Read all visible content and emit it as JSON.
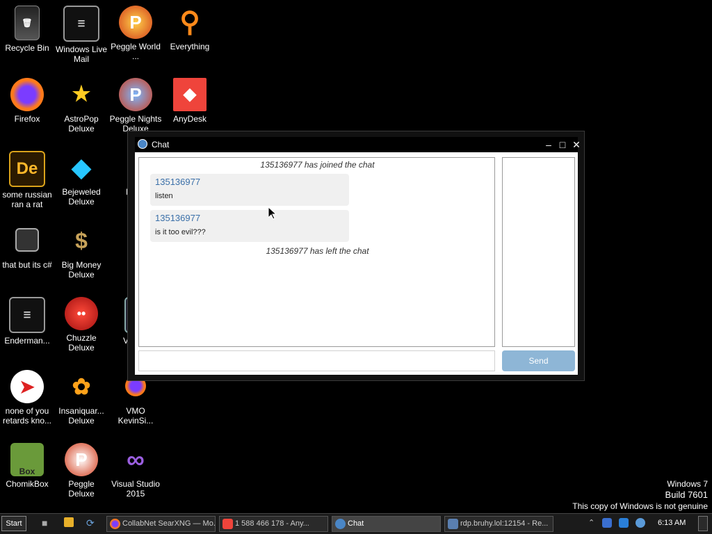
{
  "desktop": {
    "icons": [
      {
        "label": "Recycle Bin",
        "icon": "recycle-bin-icon"
      },
      {
        "label": "Windows Live Mail",
        "icon": "mail-icon"
      },
      {
        "label": "Peggle World ...",
        "icon": "peggle-icon"
      },
      {
        "label": "Everything",
        "icon": "search-icon"
      },
      {
        "label": "Firefox",
        "icon": "firefox-icon"
      },
      {
        "label": "AstroPop Deluxe",
        "icon": "astropop-icon"
      },
      {
        "label": "Peggle Nights Deluxe",
        "icon": "peggle-nights-icon"
      },
      {
        "label": "AnyDesk",
        "icon": "anydesk-icon"
      },
      {
        "label": "some russian ran a rat",
        "icon": "document-icon"
      },
      {
        "label": "Bejeweled Deluxe",
        "icon": "gem-icon"
      },
      {
        "label": "Pl Zo",
        "icon": "game-icon"
      },
      {
        "label": "that but its c#",
        "icon": "shortcut-icon"
      },
      {
        "label": "Big Money Deluxe",
        "icon": "money-bag-icon"
      },
      {
        "label": "Zum",
        "icon": "game-icon"
      },
      {
        "label": "Enderman...",
        "icon": "mail-icon"
      },
      {
        "label": "Chuzzle Deluxe",
        "icon": "chuzzle-icon"
      },
      {
        "label": "VM Ke",
        "icon": "vm-icon"
      },
      {
        "label": "none of you retards kno...",
        "icon": "bird-icon"
      },
      {
        "label": "Insaniquar... Deluxe",
        "icon": "fish-icon"
      },
      {
        "label": "VMO KevinSi...",
        "icon": "firefox-icon"
      },
      {
        "label": "ChomikBox",
        "icon": "hamster-icon"
      },
      {
        "label": "Peggle Deluxe",
        "icon": "peggle-icon"
      },
      {
        "label": "Visual Studio 2015",
        "icon": "visual-studio-icon"
      }
    ]
  },
  "chat_window": {
    "title": "Chat",
    "system_messages": [
      "135136977 has joined the chat",
      "135136977 has left the chat"
    ],
    "messages": [
      {
        "author": "135136977",
        "text": "listen"
      },
      {
        "author": "135136977",
        "text": "is it too evil???"
      }
    ],
    "input_value": "",
    "send_label": "Send"
  },
  "watermark": {
    "line1": "Windows 7",
    "line2": "Build 7601",
    "line3": "This copy of Windows is not genuine"
  },
  "taskbar": {
    "start_label": "Start",
    "tasks": [
      {
        "label": "CollabNet SearXNG — Mo...",
        "icon": "firefox-icon"
      },
      {
        "label": "1 588 466 178 - Any...",
        "icon": "anydesk-icon"
      },
      {
        "label": "Chat",
        "icon": "chat-icon"
      },
      {
        "label": "rdp.bruhy.lol:12154 - Re...",
        "icon": "remote-desktop-icon"
      }
    ],
    "clock": "6:13 AM"
  },
  "colors": {
    "accent": "#3a6fa8",
    "send_button": "#8eb6d6",
    "desktop_bg": "#000000"
  }
}
